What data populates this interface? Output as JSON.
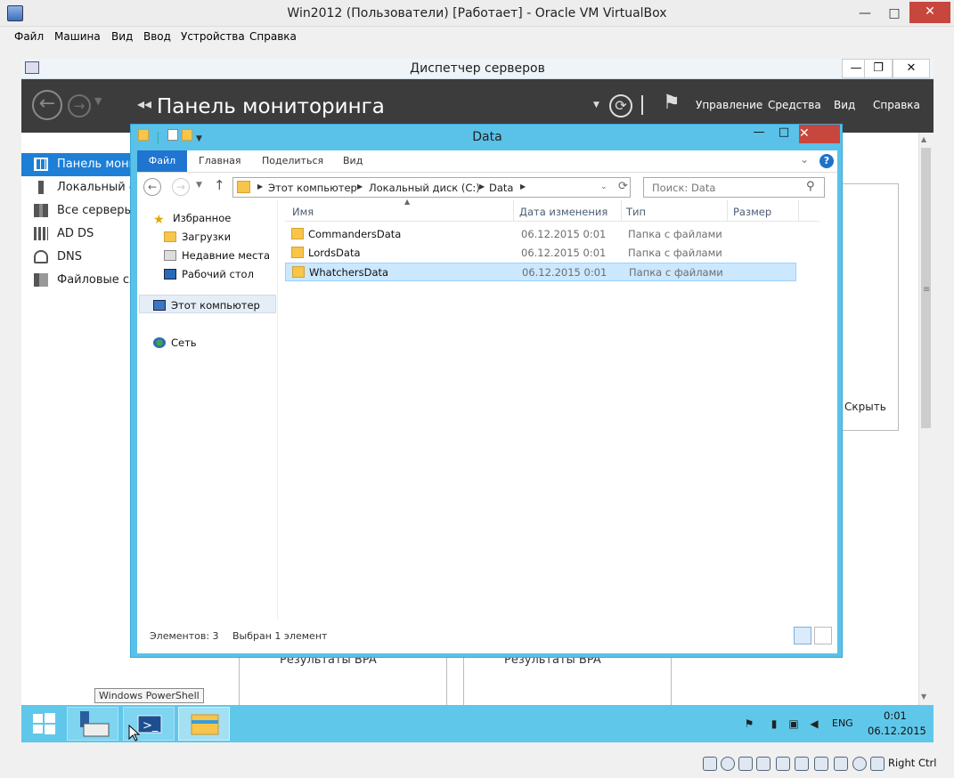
{
  "vbox": {
    "title": "Win2012 (Пользователи) [Работает] - Oracle VM VirtualBox",
    "menu": [
      "Файл",
      "Машина",
      "Вид",
      "Ввод",
      "Устройства",
      "Справка"
    ],
    "minimize": "—",
    "maximize": "□",
    "close": "✕",
    "host_key": "Right Ctrl"
  },
  "server_manager": {
    "window_title": "Диспетчер серверов",
    "page_title": "Панель мониторинга",
    "nav": [
      "Управление",
      "Средства",
      "Вид",
      "Справка"
    ],
    "sidebar": [
      {
        "label": "Панель мониторинга",
        "icon": "dashboard-icon"
      },
      {
        "label": "Локальный сервер",
        "icon": "local-server-icon"
      },
      {
        "label": "Все серверы",
        "icon": "all-servers-icon"
      },
      {
        "label": "AD DS",
        "icon": "ad-ds-icon"
      },
      {
        "label": "DNS",
        "icon": "dns-icon"
      },
      {
        "label": "Файловые службы",
        "icon": "file-services-icon"
      }
    ],
    "hide_label": "Скрыть",
    "bpa_label": "Результаты BPA"
  },
  "explorer": {
    "title": "Data",
    "ribbon_tabs": [
      "Файл",
      "Главная",
      "Поделиться",
      "Вид"
    ],
    "breadcrumb": [
      "Этот компьютер",
      "Локальный диск (C:)",
      "Data"
    ],
    "search_placeholder": "Поиск: Data",
    "nav_pane": {
      "favorites": "Избранное",
      "downloads": "Загрузки",
      "recent": "Недавние места",
      "desktop": "Рабочий стол",
      "this_pc": "Этот компьютер",
      "network": "Сеть"
    },
    "columns": [
      "Имя",
      "Дата изменения",
      "Тип",
      "Размер"
    ],
    "files": [
      {
        "name": "CommandersData",
        "date": "06.12.2015 0:01",
        "type": "Папка с файлами",
        "selected": false
      },
      {
        "name": "LordsData",
        "date": "06.12.2015 0:01",
        "type": "Папка с файлами",
        "selected": false
      },
      {
        "name": "WhatchersData",
        "date": "06.12.2015 0:01",
        "type": "Папка с файлами",
        "selected": true
      }
    ],
    "status_count": "Элементов: 3",
    "status_selected": "Выбран 1 элемент"
  },
  "taskbar": {
    "tooltip": "Windows PowerShell",
    "language": "ENG",
    "time": "0:01",
    "date": "06.12.2015"
  },
  "colors": {
    "accent_blue": "#1e7fd6",
    "taskbar": "#5fc8ea",
    "explorer_frame": "#5ac1e9",
    "close_red": "#c7463d",
    "selection": "#cce8ff"
  }
}
